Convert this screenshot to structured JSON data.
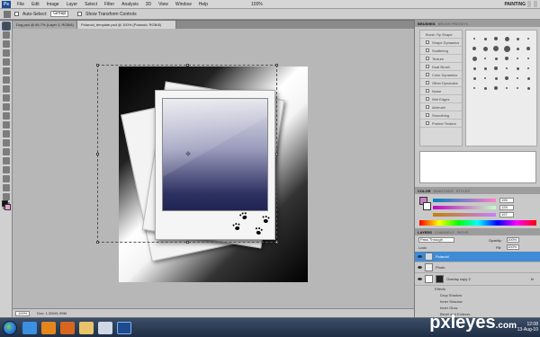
{
  "menubar": {
    "logo": "Ps",
    "items": [
      "File",
      "Edit",
      "Image",
      "Layer",
      "Select",
      "Filter",
      "Analysis",
      "3D",
      "View",
      "Window",
      "Help"
    ],
    "zoom": "100%",
    "workspace": "PAINTING"
  },
  "options": {
    "auto_select_label": "Auto-Select:",
    "auto_select_value": "Group",
    "show_transform_label": "Show Transform Controls"
  },
  "tabs": [
    {
      "label": "Dog.psd @ 66.7% (Layer 3, RGB/8)",
      "active": false
    },
    {
      "label": "Polaroid_template.psd @ 100% (Polaroid, RGB/8)",
      "active": true
    }
  ],
  "status": {
    "zoom": "100%",
    "doc_size": "Doc: 1.32M/1.99M"
  },
  "brushes": {
    "tabs": [
      "BRUSHES",
      "BRUSH PRESETS"
    ],
    "presets_label": "Brush Tip Shape",
    "options": [
      "Shape Dynamics",
      "Scattering",
      "Texture",
      "Dual Brush",
      "Color Dynamics",
      "Other Dynamics",
      "Noise",
      "Wet Edges",
      "Airbrush",
      "Smoothing",
      "Protect Texture"
    ]
  },
  "color": {
    "tabs": [
      "COLOR",
      "SWATCHES",
      "STYLES"
    ],
    "r": "196",
    "g": "128",
    "b": "197",
    "fg_color": "#c480c5"
  },
  "layers": {
    "tabs": [
      "LAYERS",
      "CHANNELS",
      "PATHS"
    ],
    "blend_mode": "Pass Through",
    "opacity_label": "Opacity:",
    "opacity": "100%",
    "lock_label": "Lock:",
    "fill_label": "Fill:",
    "fill": "100%",
    "rows": [
      {
        "name": "Polaroid",
        "selected": true
      },
      {
        "name": "Photo",
        "selected": false
      },
      {
        "name": "Overlay copy 2",
        "selected": false,
        "fx": "fx"
      }
    ],
    "effects_label": "Effects",
    "effects": [
      "Drop Shadow",
      "Inner Shadow",
      "Inner Glow",
      "Bevel and Emboss",
      "Gradient Overlay"
    ],
    "bottom_rows": [
      {
        "name": "Photo"
      },
      {
        "name": ""
      }
    ]
  },
  "taskbar": {
    "watermark": "pxleyes",
    "watermark_tld": ".com",
    "time": "12:08",
    "date": "13-Aug-10"
  }
}
